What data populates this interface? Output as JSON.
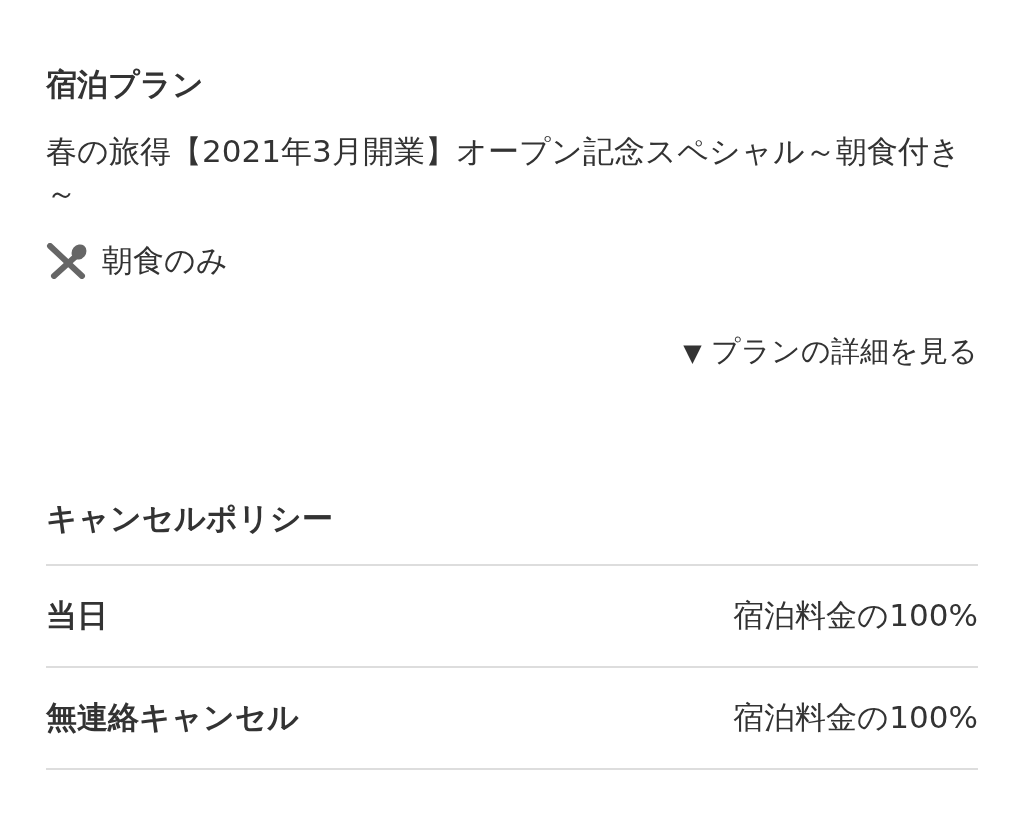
{
  "plan": {
    "heading": "宿泊プラン",
    "name": "春の旅得【2021年3月開業】オープン記念スペシャル～朝食付き～",
    "meal": "朝食のみ",
    "details_link": {
      "arrow": "▼",
      "label": "プランの詳細を見る"
    }
  },
  "cancel_policy": {
    "heading": "キャンセルポリシー",
    "rows": [
      {
        "when": "当日",
        "fee": "宿泊料金の100%"
      },
      {
        "when": "無連絡キャンセル",
        "fee": "宿泊料金の100%"
      }
    ]
  }
}
